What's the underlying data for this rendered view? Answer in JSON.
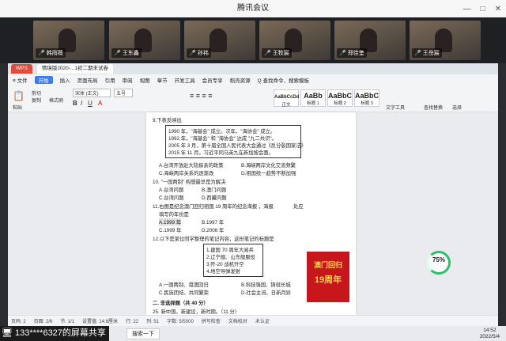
{
  "window": {
    "title": "腾讯会议",
    "controls": [
      "—",
      "□",
      "✕"
    ]
  },
  "participants": [
    {
      "name": "韩雨薇",
      "muted": true
    },
    {
      "name": "王东鑫",
      "muted": true
    },
    {
      "name": "孙祎",
      "muted": true
    },
    {
      "name": "王牧宸",
      "muted": true
    },
    {
      "name": "郑佳奎",
      "muted": true
    },
    {
      "name": "王岳宸",
      "muted": true
    }
  ],
  "wps": {
    "tabs": [
      "WPS",
      "情境版2020-...1初二期末试卷"
    ],
    "menu": [
      "≡ 文件",
      "开始",
      "插入",
      "页面布局",
      "引用",
      "审阅",
      "视图",
      "章节",
      "开发工具",
      "会员专享",
      "稻壳资源",
      "Q 查找命令、搜索模板"
    ],
    "active_menu": "开始",
    "ribbon": {
      "paste": "粘贴",
      "cut": "剪切",
      "copy": "复制",
      "format_painter": "格式刷",
      "font": "宋体 (正文)",
      "size": "五号",
      "styles": [
        {
          "sample": "AaBbCcDd",
          "name": "正文"
        },
        {
          "sample": "AaBb",
          "name": "标题 1"
        },
        {
          "sample": "AaBbC",
          "name": "标题 2"
        },
        {
          "sample": "AaBbC",
          "name": "标题 3"
        }
      ],
      "text_tools": "文字工具",
      "find_replace": "查找替换",
      "select": "选择"
    }
  },
  "doc": {
    "q9": "9.下表反映出",
    "q9_box": [
      "1990 年，\"海基会\" 成立。次年，\"海协会\" 成立。",
      "1992 年，\"海基会\" 和 \"海协会\" 达成 \"九二共识\"。",
      "2005 年 3 月，第十届全国人民代表大会通过《反分裂国家法》",
      "2015 年 11 月，习近平同马英九在新加坡会面。"
    ],
    "q9_opts": [
      "A.台湾开放赴大陆探亲的政策",
      "B.海峡两岸文化交流频繁",
      "C.海峡两岸关系的逐渐改",
      "D.祖国统一趋势不断加强"
    ],
    "q10": "10. \"一国两制\" 构想最早是为解决",
    "q10_opts": [
      "A.台湾问题",
      "B.澳门问题",
      "C.台湾问题",
      "D.西藏问题"
    ],
    "q11": "11.右图是纪念澳门回归祖国 19 周年的纪念海报 ，海报",
    "q11_tail": "处应",
    "q11b": "填写的年份是",
    "q11_opts": [
      "A.1999 年",
      "B.1997 年",
      "C.1999 年",
      "D.2008 年"
    ],
    "q12": "12.以下是某位同学整理的笔记内容，这份笔记的标题是",
    "q12_box": [
      "1.建国 70 周年大阅兵",
      "2.辽宁舰、山东舰服役",
      "3.歼-20 战机升空",
      "4.地空导弹发射"
    ],
    "q12_opts": [
      "A.一国两制、港澳回归",
      "B.科技强国、铸就长城",
      "C.民族团结、共同繁荣",
      "D.社会主流、日新月异"
    ],
    "section2": "二. 非选择题（共 40 分）",
    "q25": "25. 新中国，新建设，新时期。（11 分）",
    "poster": {
      "line1": "澳门回归",
      "line2": "19周年"
    }
  },
  "progress": {
    "label": "75%"
  },
  "status": {
    "page": "页码: 2",
    "pages": "页面: 2/6",
    "section": "节: 1/1",
    "words": "设置值: 14.8厘米",
    "line": "行: 22",
    "col": "列: 51",
    "wordcount": "字数: 5/5000",
    "spell": "拼写检查",
    "doc_check": "文档校对",
    "alert": "未认证"
  },
  "taskbar": {
    "share_text": "133****6327的屏幕共享",
    "start": "搜索一下",
    "time": "14:52",
    "date": "2022/5/4"
  }
}
